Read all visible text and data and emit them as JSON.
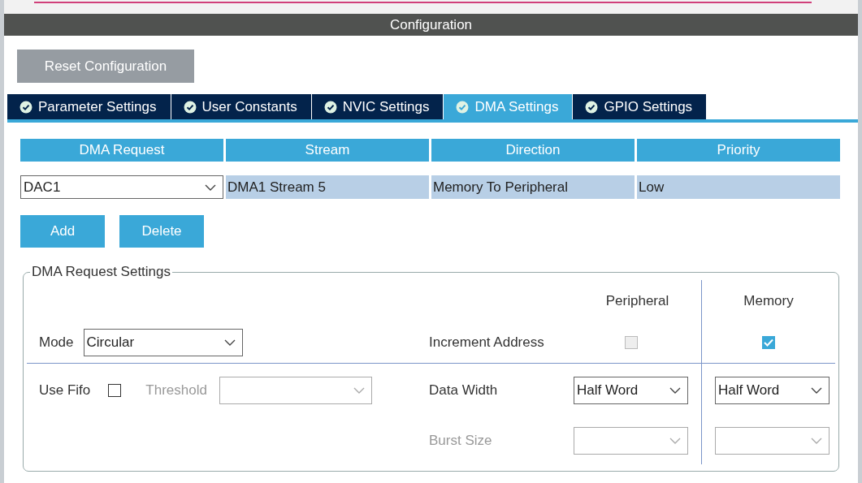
{
  "header": {
    "title": "Configuration"
  },
  "reset_button": "Reset Configuration",
  "tabs": [
    {
      "label": "Parameter Settings",
      "selected": false
    },
    {
      "label": "User Constants",
      "selected": false
    },
    {
      "label": "NVIC Settings",
      "selected": false
    },
    {
      "label": "DMA Settings",
      "selected": true
    },
    {
      "label": "GPIO Settings",
      "selected": false
    }
  ],
  "dma_table": {
    "columns": [
      "DMA Request",
      "Stream",
      "Direction",
      "Priority"
    ],
    "rows": [
      {
        "request": "DAC1",
        "stream": "DMA1 Stream 5",
        "direction": "Memory To Peripheral",
        "priority": "Low",
        "selected": true
      }
    ]
  },
  "buttons": [
    "Add",
    "Delete"
  ],
  "settings": {
    "legend": "DMA Request Settings",
    "column_headers": [
      "Peripheral",
      "Memory"
    ],
    "mode": {
      "label": "Mode",
      "value": "Circular"
    },
    "increment_address": {
      "label": "Increment Address",
      "peripheral": {
        "checked": false,
        "disabled": true
      },
      "memory": {
        "checked": true
      }
    },
    "fifo": {
      "label": "Use Fifo",
      "checked": false
    },
    "threshold": {
      "label": "Threshold",
      "disabled": true
    },
    "data_width": {
      "label": "Data Width",
      "peripheral": "Half Word",
      "memory": "Half Word"
    },
    "burst_size": {
      "label": "Burst Size",
      "disabled": true
    }
  }
}
